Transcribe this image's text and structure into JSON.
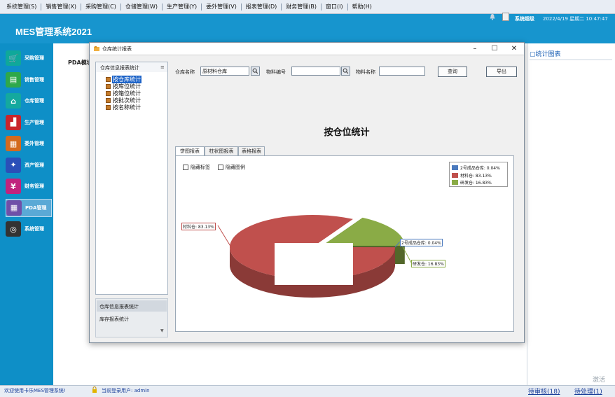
{
  "menu": [
    "系统管理(S)",
    "销售管理(X)",
    "采购管理(C)",
    "仓储管理(W)",
    "生产管理(Y)",
    "委外管理(V)",
    "报表管理(D)",
    "财务管理(B)",
    "窗口(I)",
    "帮助(H)"
  ],
  "app_title": "MES管理系统2021",
  "header": {
    "user_label": "系统超级",
    "datetime": "2022/4/19 星期二 10:47:47"
  },
  "sidebar": [
    {
      "label": "采购管理",
      "color": "#0fa89a",
      "glyph": "🛒",
      "icon": "cart-icon"
    },
    {
      "label": "销售管理",
      "color": "#2ea84a",
      "glyph": "▤",
      "icon": "sales-doc-icon"
    },
    {
      "label": "仓库管理",
      "color": "#14a99e",
      "glyph": "⌂",
      "icon": "warehouse-icon"
    },
    {
      "label": "生产管理",
      "color": "#c8242b",
      "glyph": "▟",
      "icon": "factory-icon"
    },
    {
      "label": "委外管理",
      "color": "#d36a1e",
      "glyph": "▦",
      "icon": "outsource-icon"
    },
    {
      "label": "资产管理",
      "color": "#2a4fb8",
      "glyph": "✦",
      "icon": "asset-icon"
    },
    {
      "label": "财务管理",
      "color": "#c0237e",
      "glyph": "¥",
      "icon": "finance-icon"
    },
    {
      "label": "PDA管理",
      "color": "#6f4fa8",
      "glyph": "▦",
      "icon": "calculator-icon"
    },
    {
      "label": "系统管理",
      "color": "#333333",
      "glyph": "◎",
      "icon": "system-gear-icon"
    }
  ],
  "pda_label": "PDA模块",
  "right_panel": {
    "title": "统计图表"
  },
  "watermark": "激活",
  "status": {
    "left": "欢迎使用卡乐MES管理系统!",
    "user": "当前登录用户: admin",
    "pending_review": "待审核(18)",
    "pending_handle": "待处理(1)"
  },
  "dialog": {
    "title": "仓库统计报表",
    "tree_header": "仓库信息报表统计",
    "tree_items": [
      "按仓库统计",
      "按库位统计",
      "按箱位统计",
      "按批次统计",
      "按名称统计"
    ],
    "nav_items": [
      "仓库信息报表统计",
      "库存报表统计"
    ],
    "filters": {
      "warehouse_label": "仓库名称",
      "warehouse_value": "原材料仓库",
      "material_code_label": "物料编号",
      "material_code_value": "",
      "material_name_label": "物料名称",
      "material_name_value": ""
    },
    "buttons": {
      "query": "查询",
      "export": "导出"
    },
    "chart_title": "按仓位统计",
    "tabs": [
      "饼图报表",
      "柱状图报表",
      "表格报表"
    ],
    "checkboxes": [
      "隐藏标签",
      "隐藏图例"
    ]
  },
  "chart_data": {
    "type": "pie",
    "title": "按仓位统计",
    "categories": [
      "2号成品仓库",
      "材料仓",
      "研发仓"
    ],
    "values": [
      0.04,
      83.13,
      16.83
    ],
    "legend": [
      "2号成品仓库: 0.04%",
      "材料仓: 83.13%",
      "研发仓: 16.83%"
    ],
    "labels": [
      "材料仓: 83.13%",
      "2号成品仓库: 0.04%",
      "研发仓: 16.83%"
    ],
    "colors": [
      "#4a79bd",
      "#c0504d",
      "#8aab46"
    ],
    "legend_position": "top-right"
  }
}
